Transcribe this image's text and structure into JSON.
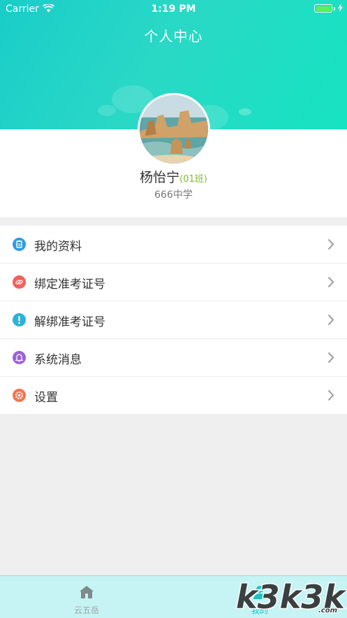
{
  "status_bar": {
    "carrier": "Carrier",
    "time": "1:19 PM",
    "battery_level": 1.0
  },
  "header": {
    "title": "个人中心",
    "gradient_colors": [
      "#19cdc8",
      "#16e3c1"
    ]
  },
  "profile": {
    "name": "杨怡宁",
    "class": "(01班)",
    "school": "666中学"
  },
  "menu": {
    "items": [
      {
        "label": "我的资料",
        "icon": "clipboard-icon",
        "color": "#2f9be3"
      },
      {
        "label": "绑定准考证号",
        "icon": "link-icon",
        "color": "#f0605c"
      },
      {
        "label": "解绑准考证号",
        "icon": "exclamation-icon",
        "color": "#2ab3d6"
      },
      {
        "label": "系统消息",
        "icon": "bell-icon",
        "color": "#9d5fd6"
      },
      {
        "label": "设置",
        "icon": "gear-icon",
        "color": "#f5734e"
      }
    ]
  },
  "tabbar": {
    "tabs": [
      {
        "label": "云五岳",
        "icon": "home-icon",
        "active": false
      },
      {
        "label": "我的",
        "icon": "person-icon",
        "active": true
      }
    ],
    "active_color": "#19c3c2",
    "inactive_color": "#9aa6a6"
  },
  "watermark": {
    "text": "k3k3k7.com"
  }
}
